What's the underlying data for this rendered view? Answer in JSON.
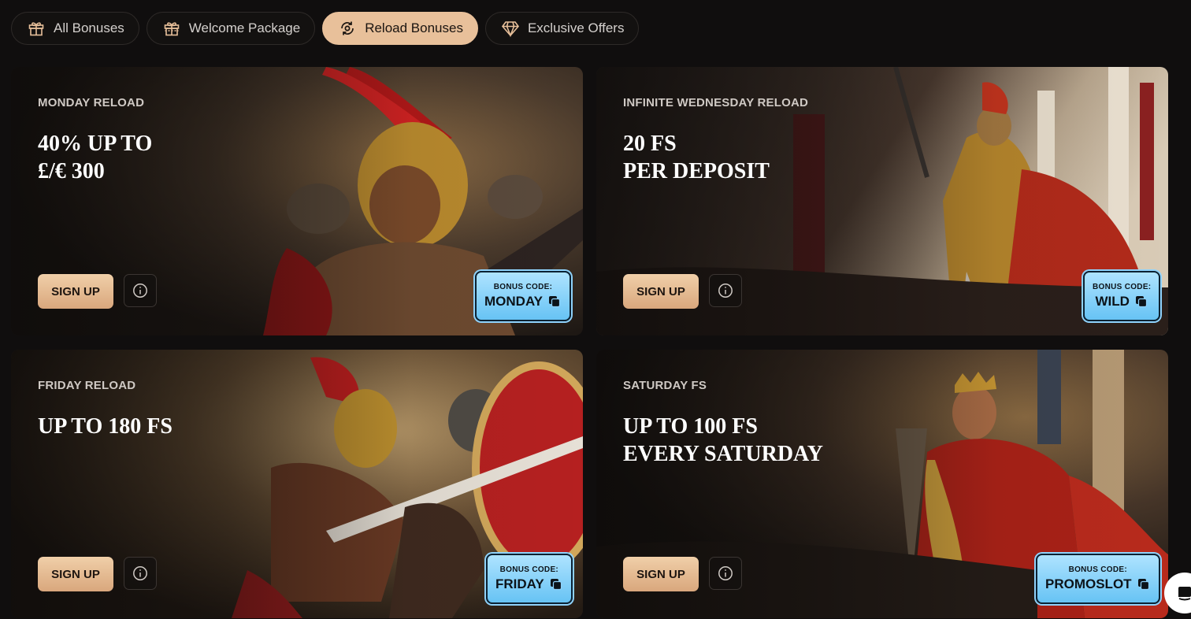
{
  "tabs": [
    {
      "label": "All Bonuses",
      "icon": "gift-icon",
      "active": false
    },
    {
      "label": "Welcome Package",
      "icon": "gift-box-icon",
      "active": false
    },
    {
      "label": "Reload Bonuses",
      "icon": "reload-icon",
      "active": true
    },
    {
      "label": "Exclusive Offers",
      "icon": "diamond-icon",
      "active": false
    }
  ],
  "cards": [
    {
      "label": "Monday Reload",
      "title": [
        "40% UP TO",
        "£/€ 300"
      ],
      "signup": "SIGN UP",
      "code_caption": "BONUS CODE:",
      "code": "MONDAY"
    },
    {
      "label": "Infinite Wednesday Reload",
      "title": [
        "20 FS",
        "PER DEPOSIT"
      ],
      "signup": "SIGN UP",
      "code_caption": "BONUS CODE:",
      "code": "WILD"
    },
    {
      "label": "Friday Reload",
      "title": [
        "UP TO 180 FS"
      ],
      "signup": "SIGN UP",
      "code_caption": "BONUS CODE:",
      "code": "FRIDAY"
    },
    {
      "label": "Saturday FS",
      "title": [
        "UP TO 100 FS",
        "EVERY SATURDAY"
      ],
      "signup": "SIGN UP",
      "code_caption": "BONUS CODE:",
      "code": "PROMOSLOT"
    }
  ],
  "colors": {
    "accent": "#e8c09a",
    "background": "#100e0e",
    "code_badge": "#8fd2fb"
  }
}
